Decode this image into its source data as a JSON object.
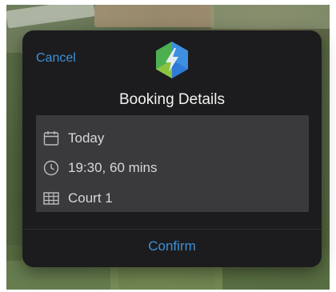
{
  "dialog": {
    "cancel_label": "Cancel",
    "title": "Booking Details",
    "confirm_label": "Confirm"
  },
  "details": [
    {
      "icon": "calendar-icon",
      "text": "Today"
    },
    {
      "icon": "clock-icon",
      "text": "19:30, 60 mins"
    },
    {
      "icon": "court-grid-icon",
      "text": "Court 1"
    }
  ],
  "colors": {
    "accent": "#3e8fd8",
    "dialog_bg": "#1c1c1e",
    "details_bg": "#3a3a3d",
    "icon_hex_green": "#4cb050",
    "icon_hex_blue": "#2e7bd6",
    "icon_bolt": "#e6edf2"
  }
}
